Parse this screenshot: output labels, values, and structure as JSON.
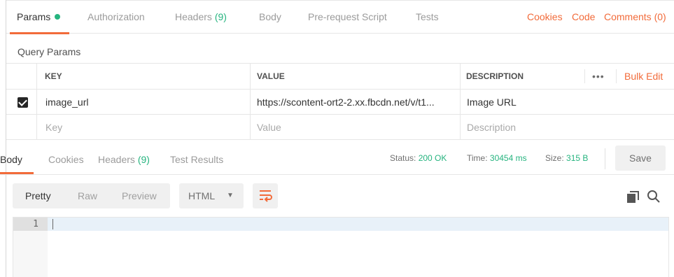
{
  "request_tabs": {
    "params": "Params",
    "authorization": "Authorization",
    "headers": "Headers",
    "headers_count": "(9)",
    "body": "Body",
    "pre_request": "Pre-request Script",
    "tests": "Tests"
  },
  "request_links": {
    "cookies": "Cookies",
    "code": "Code",
    "comments": "Comments (0)"
  },
  "query_params": {
    "title": "Query Params",
    "columns": {
      "key": "KEY",
      "value": "VALUE",
      "description": "DESCRIPTION"
    },
    "dots": "•••",
    "bulk_edit": "Bulk Edit",
    "rows": [
      {
        "checked": true,
        "key": "image_url",
        "value": "https://scontent-ort2-2.xx.fbcdn.net/v/t1...",
        "description": "Image URL"
      }
    ],
    "placeholders": {
      "key": "Key",
      "value": "Value",
      "description": "Description"
    }
  },
  "response_tabs": {
    "body": "Body",
    "cookies": "Cookies",
    "headers": "Headers",
    "headers_count": "(9)",
    "test_results": "Test Results"
  },
  "response_status": {
    "status_label": "Status:",
    "status_value": "200 OK",
    "time_label": "Time:",
    "time_value": "30454 ms",
    "size_label": "Size:",
    "size_value": "315 B",
    "save": "Save"
  },
  "toolbar": {
    "pretty": "Pretty",
    "raw": "Raw",
    "preview": "Preview",
    "format": "HTML",
    "caret": "▼"
  },
  "editor": {
    "line_number": "1"
  },
  "colors": {
    "accent": "#f26b3a",
    "success": "#26b47f"
  }
}
